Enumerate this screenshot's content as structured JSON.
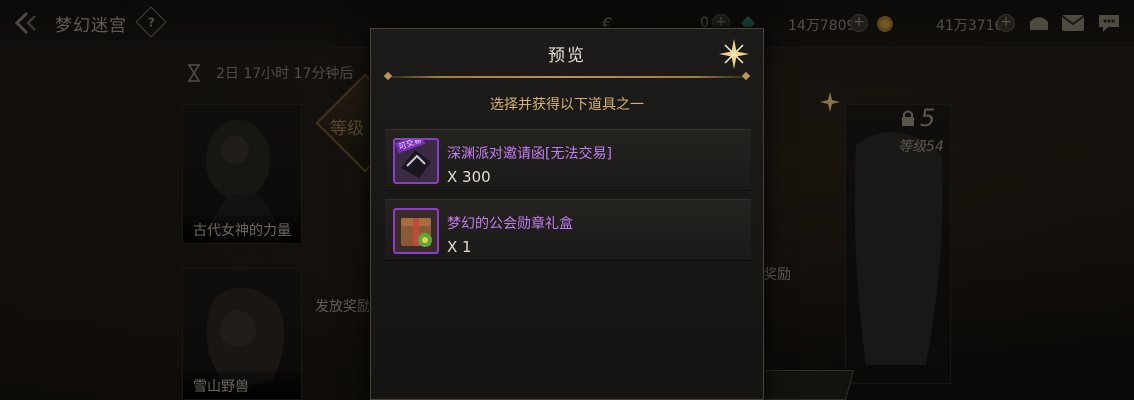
{
  "header": {
    "title": "梦幻迷宫",
    "help_symbol": "?",
    "currencies": [
      {
        "icon": "coin-icon",
        "value": "0"
      },
      {
        "icon": "gem-icon",
        "value": "14万7809"
      },
      {
        "icon": "gold-icon",
        "value": "41万3716"
      }
    ]
  },
  "background": {
    "countdown": "2日 17小时 17分钟后",
    "cards": [
      {
        "label": "古代女神的力量"
      },
      {
        "label": "雪山野兽"
      }
    ],
    "level_badge": "等级",
    "reward_label_left": "发放奖励",
    "reward_label_right": "奖励",
    "right_card": {
      "count": "5",
      "level": "等级54"
    }
  },
  "modal": {
    "title": "预览",
    "subtitle": "选择并获得以下道具之一",
    "items": [
      {
        "name": "深渊派对邀请函[无法交易]",
        "quantity": "X 300",
        "tag": "可交易",
        "icon": "invitation-icon"
      },
      {
        "name": "梦幻的公会勋章礼盒",
        "quantity": "X 1",
        "icon": "gift-box-icon"
      }
    ]
  },
  "colors": {
    "rare_item_purple": "#c27df0",
    "subtitle_gold": "#d6b36c",
    "divider_gold": "#b89257"
  }
}
